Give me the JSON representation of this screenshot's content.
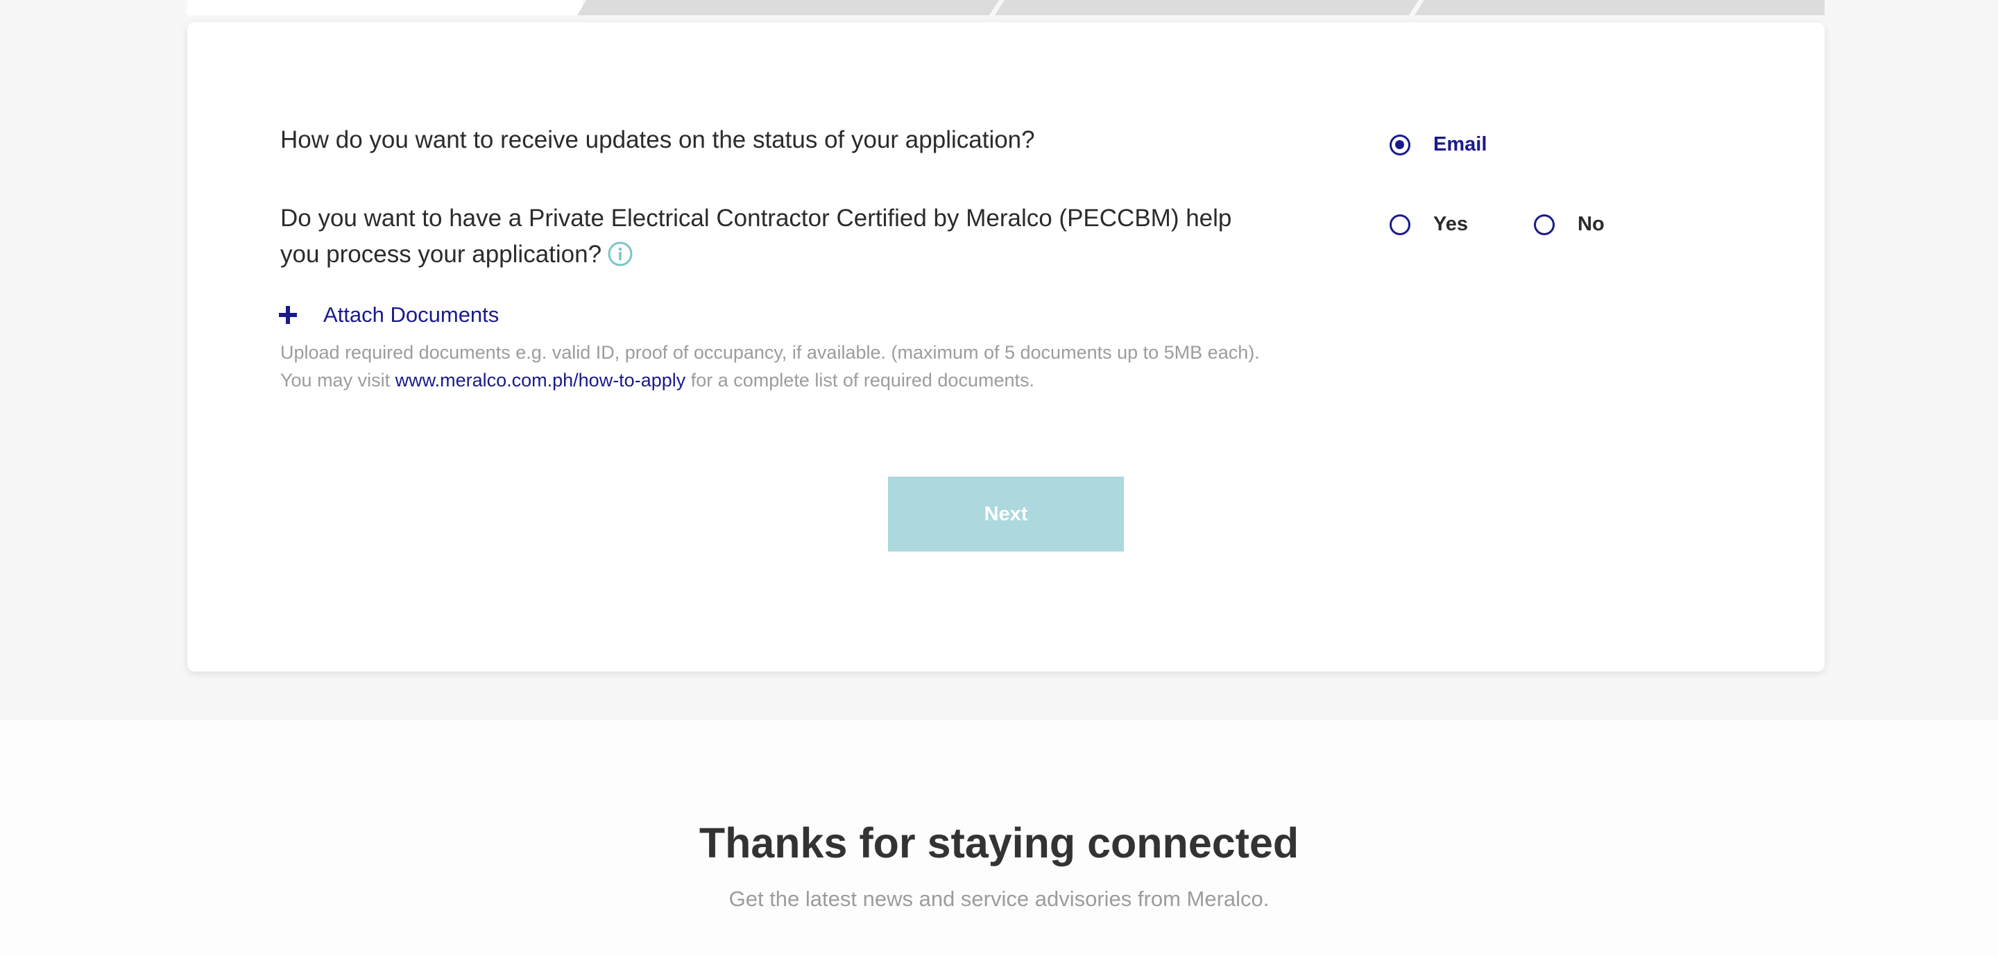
{
  "form": {
    "question_updates": "How do you want to receive updates on the status of your application?",
    "update_options": [
      {
        "label": "Email",
        "selected": true
      }
    ],
    "question_peccbm": "Do you want to have a Private Electrical Contractor Certified by Meralco (PECCBM) help you process your application?",
    "peccbm_options": [
      {
        "label": "Yes",
        "selected": false
      },
      {
        "label": "No",
        "selected": false
      }
    ],
    "attach_label": "Attach Documents",
    "help_line1": "Upload required documents e.g. valid ID, proof of occupancy, if available. (maximum of 5 documents up to 5MB each).",
    "help_line2_prefix": "You may visit ",
    "help_link": "www.meralco.com.ph/how-to-apply",
    "help_line2_suffix": " for a complete list of required documents.",
    "next_label": "Next"
  },
  "footer": {
    "title": "Thanks for staying connected",
    "subtitle": "Get the latest news and service advisories from Meralco."
  },
  "colors": {
    "accent": "#1a1a8c",
    "button": "#acd8de",
    "info": "#7cc4c9",
    "muted_text": "#9c9c9c",
    "step_inactive": "#dcdcdc"
  },
  "icons": {
    "info": "info-circle-icon",
    "attach": "plus-icon"
  }
}
